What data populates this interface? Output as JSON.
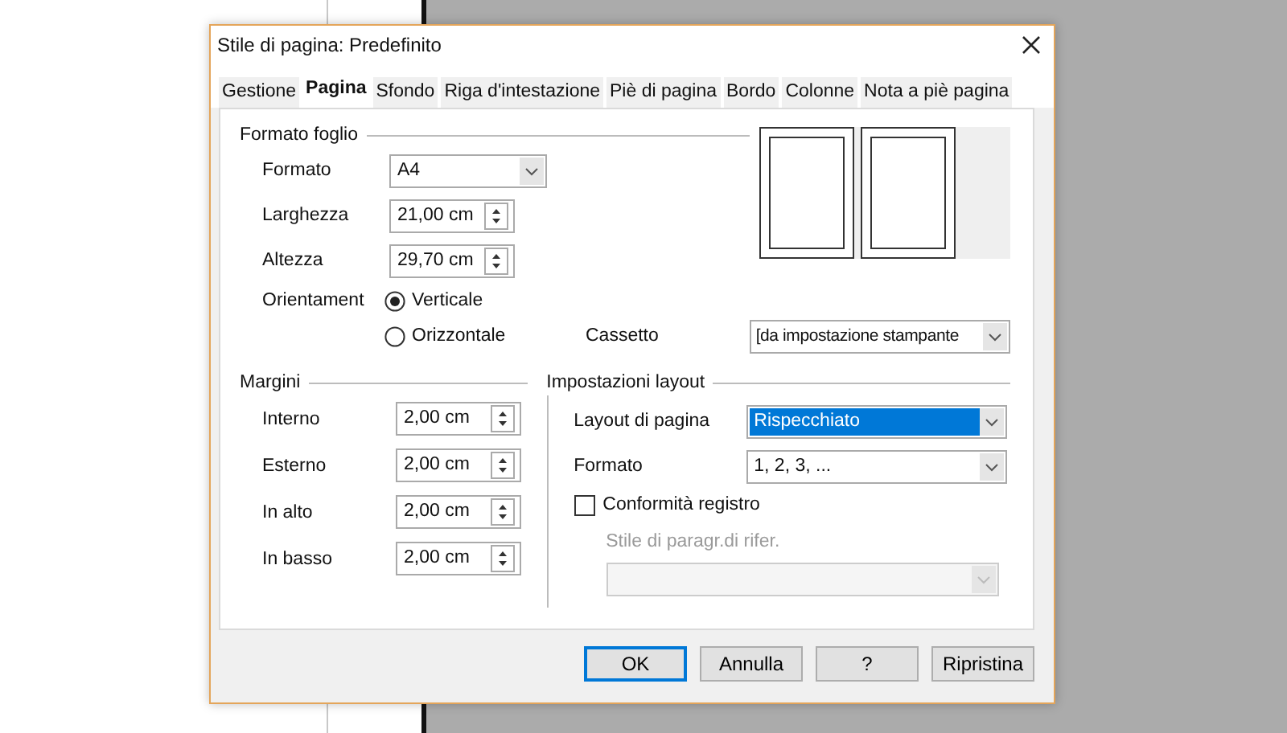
{
  "window": {
    "title": "Stile di pagina: Predefinito"
  },
  "tabs": [
    {
      "label": "Gestione",
      "selected": false
    },
    {
      "label": "Pagina",
      "selected": true
    },
    {
      "label": "Sfondo",
      "selected": false
    },
    {
      "label": "Riga d'intestazione",
      "selected": false
    },
    {
      "label": "Piè di pagina",
      "selected": false
    },
    {
      "label": "Bordo",
      "selected": false
    },
    {
      "label": "Colonne",
      "selected": false
    },
    {
      "label": "Nota a piè pagina",
      "selected": false
    }
  ],
  "page_format": {
    "title": "Formato foglio",
    "fields": [
      {
        "kind": "dropdown",
        "label": "Formato",
        "value": "A4"
      },
      {
        "kind": "spin",
        "label": "Larghezza",
        "value": "21,00 cm"
      },
      {
        "kind": "spin",
        "label": "Altezza",
        "value": "29,70 cm"
      }
    ],
    "orientation": {
      "label": "Orientament",
      "options": [
        {
          "label": "Verticale",
          "selected": true
        },
        {
          "label": "Orizzontale",
          "selected": false
        }
      ]
    },
    "tray": {
      "label": "Cassetto",
      "value": "[da impostazione stampante"
    }
  },
  "margins": {
    "title": "Margini",
    "fields": [
      {
        "label": "Interno",
        "value": "2,00 cm"
      },
      {
        "label": "Esterno",
        "value": "2,00 cm"
      },
      {
        "label": "In alto",
        "value": "2,00 cm"
      },
      {
        "label": "In basso",
        "value": "2,00 cm"
      }
    ]
  },
  "layout_settings": {
    "title": "Impostazioni layout",
    "page_layout": {
      "label": "Layout di pagina",
      "value": "Rispecchiato",
      "selected": true
    },
    "format": {
      "label": "Formato",
      "value": "1, 2, 3, ...",
      "selected": false
    },
    "register_true": {
      "label": "Conformità registro",
      "checked": false
    },
    "reference_style": {
      "label": "Stile di paragr.di rifer.",
      "disabled": true
    }
  },
  "buttons": [
    {
      "label": "OK",
      "default": true
    },
    {
      "label": "Annulla",
      "default": false
    },
    {
      "label": "?",
      "default": false
    },
    {
      "label": "Ripristina",
      "default": false
    }
  ]
}
